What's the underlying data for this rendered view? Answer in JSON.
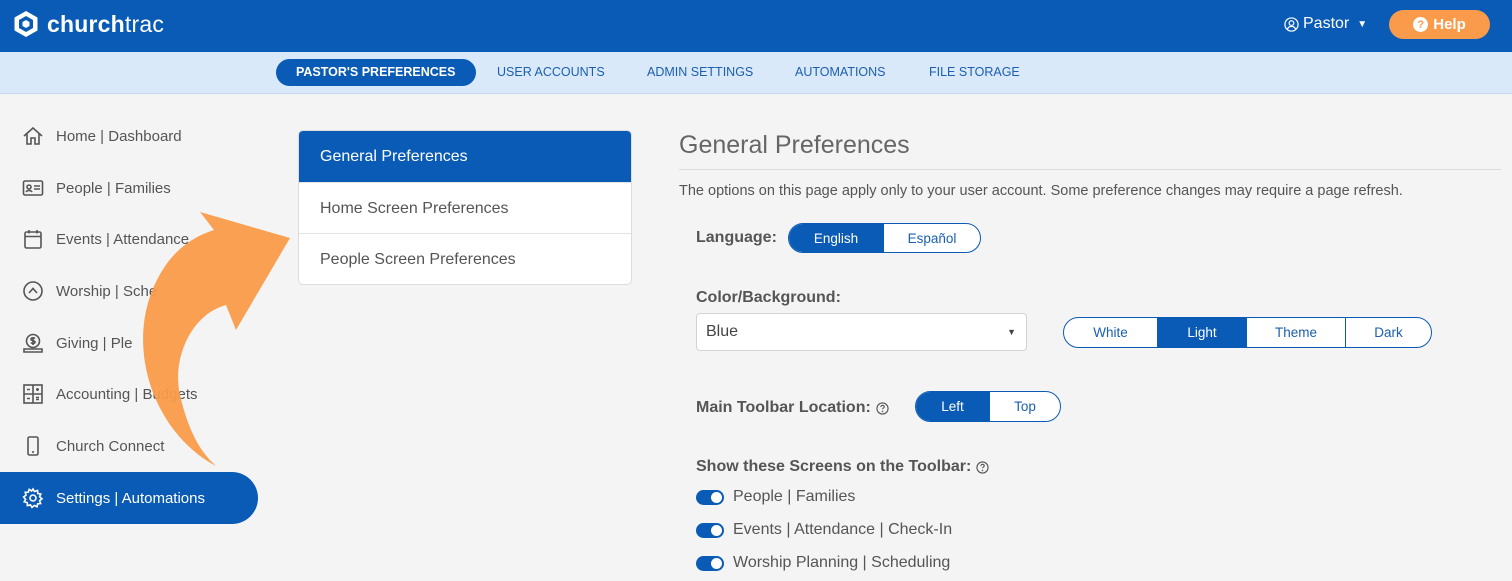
{
  "app": {
    "brand_strong": "church",
    "brand_light": "trac",
    "user_label": "Pastor",
    "help_label": "Help"
  },
  "subnav": {
    "tabs": [
      {
        "label": "PASTOR'S PREFERENCES",
        "active": true
      },
      {
        "label": "USER ACCOUNTS",
        "active": false
      },
      {
        "label": "ADMIN SETTINGS",
        "active": false
      },
      {
        "label": "AUTOMATIONS",
        "active": false
      },
      {
        "label": "FILE STORAGE",
        "active": false
      }
    ]
  },
  "sidebar": {
    "items": [
      {
        "label": "Home | Dashboard",
        "icon": "home-icon"
      },
      {
        "label": "People | Families",
        "icon": "id-card-icon"
      },
      {
        "label": "Events | Attendance",
        "icon": "calendar-icon"
      },
      {
        "label": "Worship | Sche",
        "icon": "chevron-circle-icon"
      },
      {
        "label": "Giving | Ple",
        "icon": "money-icon"
      },
      {
        "label": "Accounting | Budgets",
        "icon": "ledger-icon"
      },
      {
        "label": "Church Connect",
        "icon": "phone-icon"
      },
      {
        "label": "Settings | Automations",
        "icon": "gear-icon",
        "active": true
      }
    ]
  },
  "pref_menu": {
    "items": [
      {
        "label": "General Preferences",
        "active": true
      },
      {
        "label": "Home Screen Preferences",
        "active": false
      },
      {
        "label": "People Screen Preferences",
        "active": false
      }
    ]
  },
  "main": {
    "title": "General Preferences",
    "description": "The options on this page apply only to your user account. Some preference changes may require a page refresh.",
    "language": {
      "label": "Language:",
      "options": [
        "English",
        "Español"
      ],
      "selected": "English"
    },
    "color": {
      "label": "Color/Background:",
      "selected_value": "Blue",
      "mode_options": [
        "White",
        "Light",
        "Theme",
        "Dark"
      ],
      "selected_mode": "Light"
    },
    "toolbar_location": {
      "label": "Main Toolbar Location:",
      "options": [
        "Left",
        "Top"
      ],
      "selected": "Left"
    },
    "toolbar_screens": {
      "label": "Show these Screens on the Toolbar:",
      "items": [
        {
          "label": "People | Families",
          "on": true
        },
        {
          "label": "Events | Attendance | Check-In",
          "on": true
        },
        {
          "label": "Worship Planning | Scheduling",
          "on": true
        }
      ]
    }
  },
  "colors": {
    "brand_blue": "#0a5bb5",
    "subnav_bg": "#d9e9f9",
    "accent_orange": "#f99b4a"
  }
}
